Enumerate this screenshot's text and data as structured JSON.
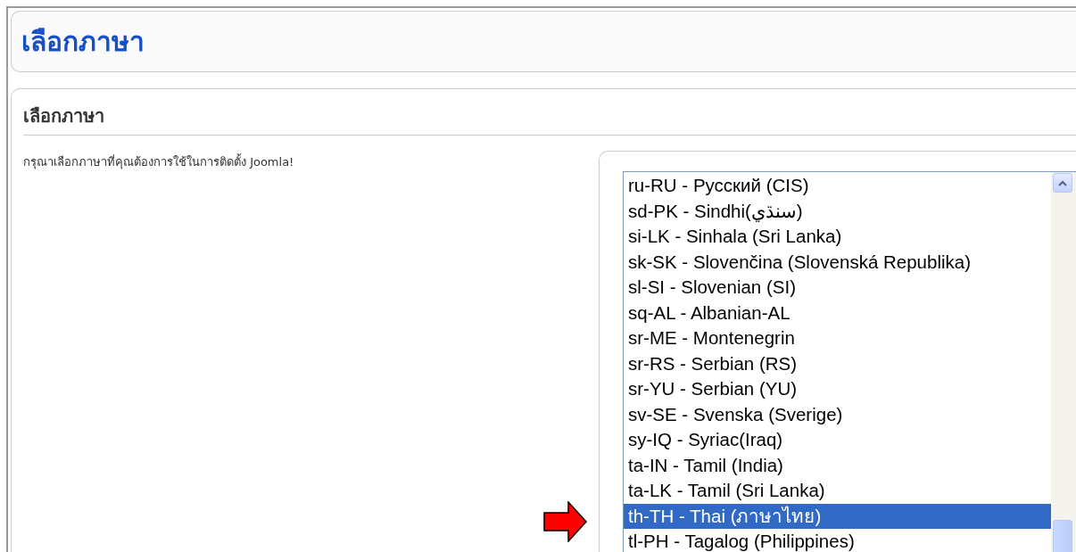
{
  "page_title": "เลือกภาษา",
  "section": {
    "heading": "เลือกภาษา",
    "instruction": "กรุณาเลือกภาษาที่คุณต้องการใช้ในการติดตั้ง Joomla!"
  },
  "language_list": [
    {
      "label": "ru-RU - Русский (CIS)",
      "selected": false
    },
    {
      "label": "sd-PK - Sindhi(سنڌي)",
      "selected": false
    },
    {
      "label": "si-LK - Sinhala (Sri Lanka)",
      "selected": false
    },
    {
      "label": "sk-SK - Slovenčina (Slovenská Republika)",
      "selected": false
    },
    {
      "label": "sl-SI - Slovenian (SI)",
      "selected": false
    },
    {
      "label": "sq-AL - Albanian-AL",
      "selected": false
    },
    {
      "label": "sr-ME - Montenegrin",
      "selected": false
    },
    {
      "label": "sr-RS - Serbian (RS)",
      "selected": false
    },
    {
      "label": "sr-YU - Serbian (YU)",
      "selected": false
    },
    {
      "label": "sv-SE - Svenska (Sverige)",
      "selected": false
    },
    {
      "label": "sy-IQ - Syriac(Iraq)",
      "selected": false
    },
    {
      "label": "ta-IN - Tamil (India)",
      "selected": false
    },
    {
      "label": "ta-LK - Tamil (Sri Lanka)",
      "selected": false
    },
    {
      "label": "th-TH - Thai (ภาษาไทย)",
      "selected": true
    },
    {
      "label": "tl-PH - Tagalog (Philippines)",
      "selected": false
    }
  ]
}
